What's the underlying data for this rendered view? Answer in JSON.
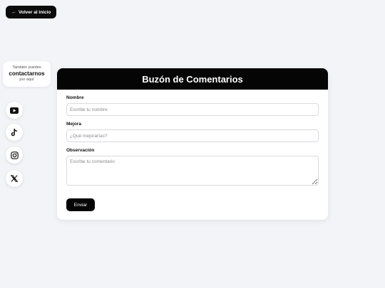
{
  "back_button": {
    "arrow": "←",
    "label": "Volver al inicio"
  },
  "contact": {
    "line1": "También puedes",
    "line2": "contactarnos",
    "line3": "por aquí"
  },
  "social": [
    {
      "name": "youtube-icon"
    },
    {
      "name": "tiktok-icon"
    },
    {
      "name": "instagram-icon"
    },
    {
      "name": "x-icon"
    }
  ],
  "form": {
    "title": "Buzón de Comentarios",
    "fields": {
      "nombre": {
        "label": "Nombre",
        "placeholder": "Escribe tu nombre",
        "value": ""
      },
      "mejora": {
        "label": "Mejora",
        "placeholder": "¿Qué mejorarías?",
        "value": ""
      },
      "observacion": {
        "label": "Observación",
        "placeholder": "Escribe tu comentario",
        "value": ""
      }
    },
    "submit_label": "Enviar"
  },
  "colors": {
    "background": "#f3f4f8",
    "primary": "#050505",
    "card": "#ffffff",
    "border": "#d9dbe1"
  }
}
